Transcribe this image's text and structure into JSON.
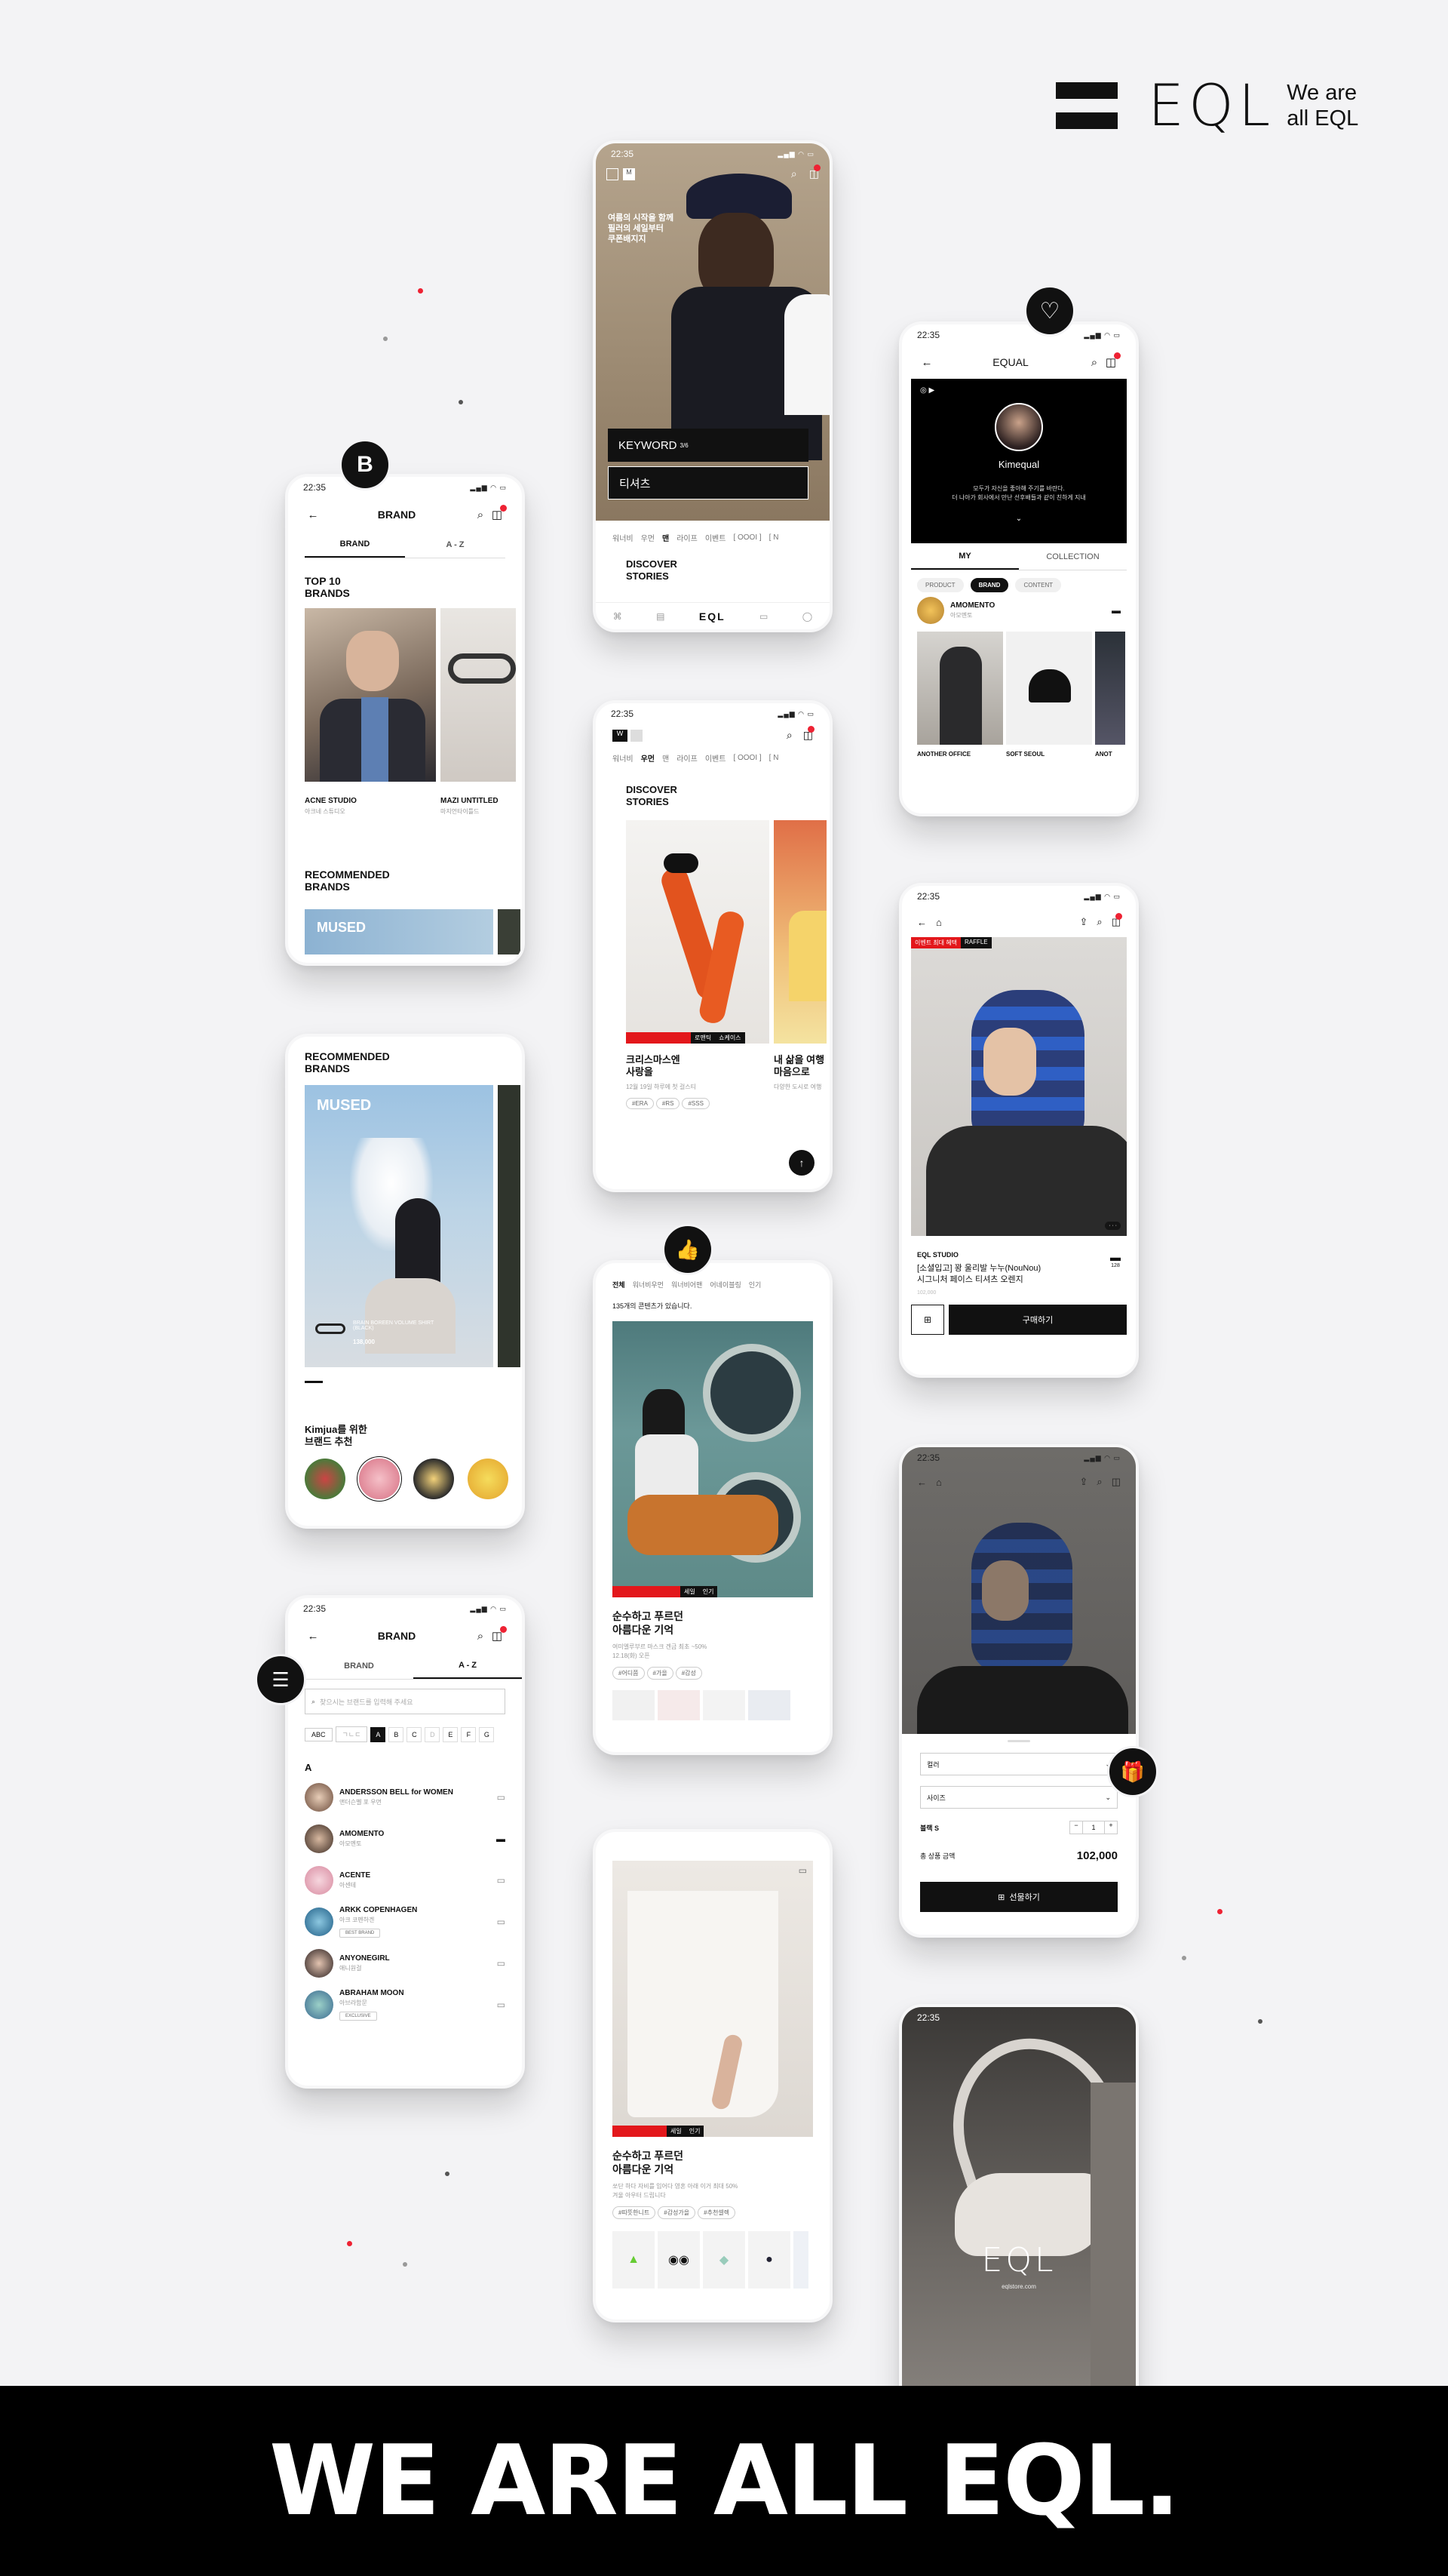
{
  "brand": {
    "logo": "EQL",
    "tagline_1": "We are",
    "tagline_2": "all EQL",
    "slogan": "WE ARE ALL EQL."
  },
  "status_time": "22:35",
  "phone_brand": {
    "title": "BRAND",
    "tabs": [
      "BRAND",
      "A - Z"
    ],
    "top10": "TOP 10\nBRANDS",
    "cards": [
      {
        "name": "ACNE STUDIO",
        "sub": "아크네 스튜디오"
      },
      {
        "name": "MAZI UNTITLED",
        "sub": "마지언타이틀드"
      }
    ],
    "recommended": "RECOMMENDED\nBRANDS",
    "banner": "MUSED"
  },
  "phone_recommended": {
    "title": "RECOMMENDED\nBRANDS",
    "banner": "MUSED",
    "product_name": "BRAIN BOREEN VOLUME SHIRT (BLACK)",
    "product_price": "138,000",
    "personal": "Kimjua를 위한\n브랜드 추천"
  },
  "phone_az": {
    "title": "BRAND",
    "tabs": [
      "BRAND",
      "A - Z"
    ],
    "search_placeholder": "찾으시는 브랜드를 입력해 주세요",
    "filters": [
      "ABC",
      "ㄱㄴㄷ",
      "A",
      "B",
      "C",
      "D",
      "E",
      "F",
      "G"
    ],
    "section": "A",
    "items": [
      {
        "name": "ANDERSSON BELL for WOMEN",
        "sub": "앤더슨벨 포 우먼"
      },
      {
        "name": "AMOMENTO",
        "sub": "아모멘토"
      },
      {
        "name": "ACENTE",
        "sub": "아센테"
      },
      {
        "name": "ARKK COPENHAGEN",
        "sub": "아크 코펜하겐",
        "badge": "BEST BRAND"
      },
      {
        "name": "ANYONEGIRL",
        "sub": "애니원걸"
      },
      {
        "name": "ABRAHAM MOON",
        "sub": "아브라함문",
        "badge": "EXCLUSIVE"
      }
    ]
  },
  "phone_keyword": {
    "headline": "여름의 시작을 함께\n필러의 세일부터\n쿠폰배지지",
    "keyword": "KEYWORD",
    "keyword_sup": "3/6",
    "keyword_value": "티셔츠",
    "categories": [
      "워너비",
      "우먼",
      "맨",
      "라이프",
      "이벤트",
      "[ OOOI ]",
      "[ N"
    ],
    "discover": "DISCOVER\nSTORIES",
    "tabbar_logo": "EQL"
  },
  "phone_discover": {
    "categories": [
      "워너비",
      "우먼",
      "맨",
      "라이프",
      "이벤트",
      "[ OOOI ]",
      "[ N"
    ],
    "discover": "DISCOVER\nSTORIES",
    "story1_title": "크리스마스엔\n사랑을",
    "story1_desc": "12월 19일 하루에 첫 걸스티",
    "story1_chips": [
      "#ERA",
      "#RS",
      "#SSS"
    ],
    "story1_tags": [
      "로맨틱",
      "쇼케이스"
    ],
    "story2_title": "내 삶을 여행\n마음으로",
    "story2_desc": "다양한 도시로 여행"
  },
  "phone_coupon": {
    "categories": [
      "전체",
      "워너비우먼",
      "워너비어맨",
      "어네이블링",
      "인기"
    ],
    "count_text": "135개의 콘텐츠가 있습니다.",
    "title": "순수하고 푸르던\n아름다운 기억",
    "desc": "여미엘루부르 마스크 겐금 최초 ~50%\n12.18(화) 오픈",
    "chips": [
      "#어디쯤",
      "#가을",
      "#감성"
    ],
    "tags": [
      "세일",
      "인기"
    ]
  },
  "phone_white": {
    "title": "순수하고 푸르던\n아름다운 기억",
    "desc": "쏘단 하다 자비를 입어다 영혼 아래 이거 최대 50%\n겨울 아우터 드립니다",
    "chips": [
      "#따뜻한니트",
      "#감성가을",
      "#추천셀렉"
    ],
    "tags": [
      "세일",
      "인기"
    ]
  },
  "phone_equal": {
    "title": "EQUAL",
    "profile_name": "Kimequal",
    "profile_desc": "모두가 자신을 좋아해 주기를 바란다.\n더 나아가 회사에서 만난 선후배들과 같이 친하게 지내",
    "tabs": [
      "MY",
      "COLLECTION"
    ],
    "filters": [
      "PRODUCT",
      "BRAND",
      "CONTENT"
    ],
    "brand_name": "AMOMENTO",
    "brand_sub": "아모멘토",
    "products": [
      "ANOTHER OFFICE",
      "SOFT SEOUL",
      "ANOT"
    ]
  },
  "phone_product": {
    "tags": [
      "이벤트 최대 혜택",
      "RAFFLE"
    ],
    "brand": "EQL STUDIO",
    "name": "[소셜입고] 꽝 울리발 누누(NouNou)\n시그니처 페이스 티셔츠 오렌지",
    "price": "102,000",
    "buy": "구매하기",
    "likes": "128"
  },
  "phone_option": {
    "select1": "컬러",
    "select2": "사이즈",
    "qty_label": "블랙 S",
    "qty": "1",
    "total_label": "총 상품 금액",
    "total": "102,000",
    "gift": "선물하기"
  },
  "phone_splash": {
    "logo": "EQL",
    "url": "eqlstore.com"
  },
  "colors": {
    "accent": "#e3171b",
    "black": "#111111",
    "bg": "#f3f3f5"
  },
  "icons": [
    "heart-icon",
    "brand-b-icon",
    "thumbs-up-icon",
    "list-icon",
    "gift-icon",
    "search-icon",
    "cart-icon",
    "back-icon"
  ]
}
